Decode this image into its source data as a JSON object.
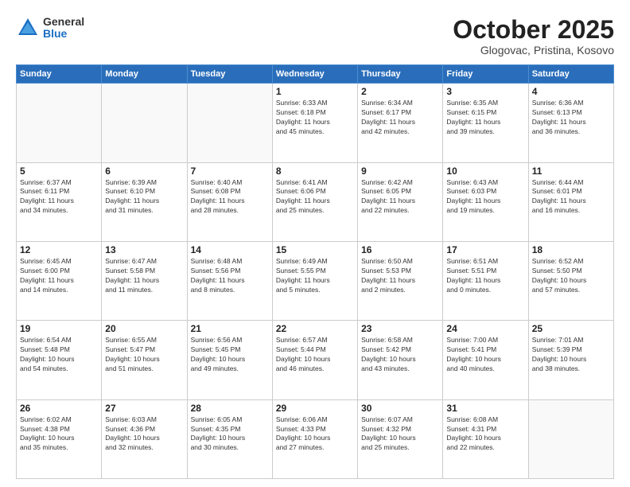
{
  "logo": {
    "general": "General",
    "blue": "Blue"
  },
  "header": {
    "month": "October 2025",
    "location": "Glogovac, Pristina, Kosovo"
  },
  "weekdays": [
    "Sunday",
    "Monday",
    "Tuesday",
    "Wednesday",
    "Thursday",
    "Friday",
    "Saturday"
  ],
  "weeks": [
    [
      {
        "day": "",
        "info": ""
      },
      {
        "day": "",
        "info": ""
      },
      {
        "day": "",
        "info": ""
      },
      {
        "day": "1",
        "info": "Sunrise: 6:33 AM\nSunset: 6:18 PM\nDaylight: 11 hours\nand 45 minutes."
      },
      {
        "day": "2",
        "info": "Sunrise: 6:34 AM\nSunset: 6:17 PM\nDaylight: 11 hours\nand 42 minutes."
      },
      {
        "day": "3",
        "info": "Sunrise: 6:35 AM\nSunset: 6:15 PM\nDaylight: 11 hours\nand 39 minutes."
      },
      {
        "day": "4",
        "info": "Sunrise: 6:36 AM\nSunset: 6:13 PM\nDaylight: 11 hours\nand 36 minutes."
      }
    ],
    [
      {
        "day": "5",
        "info": "Sunrise: 6:37 AM\nSunset: 6:11 PM\nDaylight: 11 hours\nand 34 minutes."
      },
      {
        "day": "6",
        "info": "Sunrise: 6:39 AM\nSunset: 6:10 PM\nDaylight: 11 hours\nand 31 minutes."
      },
      {
        "day": "7",
        "info": "Sunrise: 6:40 AM\nSunset: 6:08 PM\nDaylight: 11 hours\nand 28 minutes."
      },
      {
        "day": "8",
        "info": "Sunrise: 6:41 AM\nSunset: 6:06 PM\nDaylight: 11 hours\nand 25 minutes."
      },
      {
        "day": "9",
        "info": "Sunrise: 6:42 AM\nSunset: 6:05 PM\nDaylight: 11 hours\nand 22 minutes."
      },
      {
        "day": "10",
        "info": "Sunrise: 6:43 AM\nSunset: 6:03 PM\nDaylight: 11 hours\nand 19 minutes."
      },
      {
        "day": "11",
        "info": "Sunrise: 6:44 AM\nSunset: 6:01 PM\nDaylight: 11 hours\nand 16 minutes."
      }
    ],
    [
      {
        "day": "12",
        "info": "Sunrise: 6:45 AM\nSunset: 6:00 PM\nDaylight: 11 hours\nand 14 minutes."
      },
      {
        "day": "13",
        "info": "Sunrise: 6:47 AM\nSunset: 5:58 PM\nDaylight: 11 hours\nand 11 minutes."
      },
      {
        "day": "14",
        "info": "Sunrise: 6:48 AM\nSunset: 5:56 PM\nDaylight: 11 hours\nand 8 minutes."
      },
      {
        "day": "15",
        "info": "Sunrise: 6:49 AM\nSunset: 5:55 PM\nDaylight: 11 hours\nand 5 minutes."
      },
      {
        "day": "16",
        "info": "Sunrise: 6:50 AM\nSunset: 5:53 PM\nDaylight: 11 hours\nand 2 minutes."
      },
      {
        "day": "17",
        "info": "Sunrise: 6:51 AM\nSunset: 5:51 PM\nDaylight: 11 hours\nand 0 minutes."
      },
      {
        "day": "18",
        "info": "Sunrise: 6:52 AM\nSunset: 5:50 PM\nDaylight: 10 hours\nand 57 minutes."
      }
    ],
    [
      {
        "day": "19",
        "info": "Sunrise: 6:54 AM\nSunset: 5:48 PM\nDaylight: 10 hours\nand 54 minutes."
      },
      {
        "day": "20",
        "info": "Sunrise: 6:55 AM\nSunset: 5:47 PM\nDaylight: 10 hours\nand 51 minutes."
      },
      {
        "day": "21",
        "info": "Sunrise: 6:56 AM\nSunset: 5:45 PM\nDaylight: 10 hours\nand 49 minutes."
      },
      {
        "day": "22",
        "info": "Sunrise: 6:57 AM\nSunset: 5:44 PM\nDaylight: 10 hours\nand 46 minutes."
      },
      {
        "day": "23",
        "info": "Sunrise: 6:58 AM\nSunset: 5:42 PM\nDaylight: 10 hours\nand 43 minutes."
      },
      {
        "day": "24",
        "info": "Sunrise: 7:00 AM\nSunset: 5:41 PM\nDaylight: 10 hours\nand 40 minutes."
      },
      {
        "day": "25",
        "info": "Sunrise: 7:01 AM\nSunset: 5:39 PM\nDaylight: 10 hours\nand 38 minutes."
      }
    ],
    [
      {
        "day": "26",
        "info": "Sunrise: 6:02 AM\nSunset: 4:38 PM\nDaylight: 10 hours\nand 35 minutes."
      },
      {
        "day": "27",
        "info": "Sunrise: 6:03 AM\nSunset: 4:36 PM\nDaylight: 10 hours\nand 32 minutes."
      },
      {
        "day": "28",
        "info": "Sunrise: 6:05 AM\nSunset: 4:35 PM\nDaylight: 10 hours\nand 30 minutes."
      },
      {
        "day": "29",
        "info": "Sunrise: 6:06 AM\nSunset: 4:33 PM\nDaylight: 10 hours\nand 27 minutes."
      },
      {
        "day": "30",
        "info": "Sunrise: 6:07 AM\nSunset: 4:32 PM\nDaylight: 10 hours\nand 25 minutes."
      },
      {
        "day": "31",
        "info": "Sunrise: 6:08 AM\nSunset: 4:31 PM\nDaylight: 10 hours\nand 22 minutes."
      },
      {
        "day": "",
        "info": ""
      }
    ]
  ]
}
